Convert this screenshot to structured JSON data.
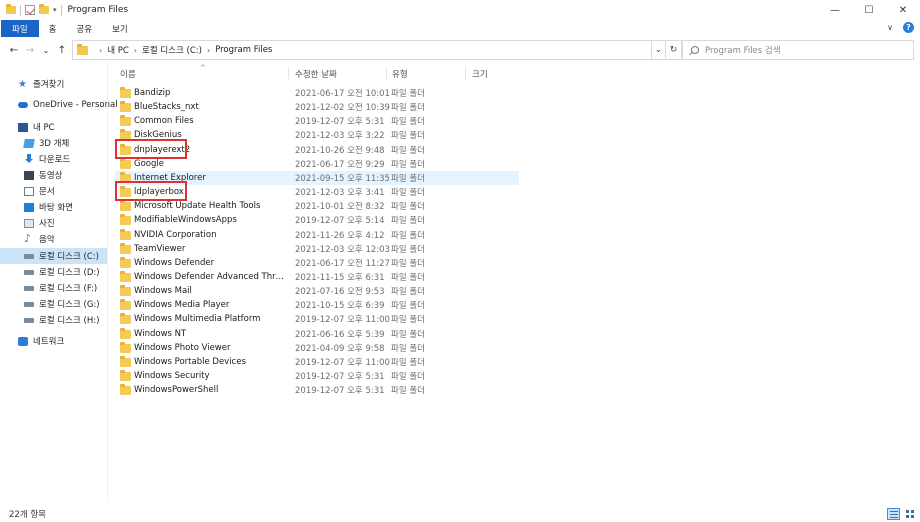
{
  "window": {
    "title": "Program Files",
    "minimize_glyph": "—",
    "maximize_glyph": "☐",
    "close_glyph": "✕"
  },
  "ribbon": {
    "tabs": [
      "파일",
      "홈",
      "공유",
      "보기"
    ],
    "help": "?"
  },
  "nav_buttons": {
    "back": "←",
    "forward": "→",
    "recent": "⌄",
    "up": "↑"
  },
  "address": {
    "crumbs": [
      "내 PC",
      "로컬 디스크 (C:)",
      "Program Files"
    ],
    "refresh": "↻",
    "dropdown": "⌄"
  },
  "search": {
    "placeholder": "Program Files 검색"
  },
  "sidebar": {
    "items": [
      {
        "label": "즐겨찾기",
        "icon": "star-icon"
      },
      {
        "label": "OneDrive - Personal",
        "icon": "cloud-icon"
      },
      {
        "label": "내 PC",
        "icon": "computer-icon"
      },
      {
        "label": "3D 개체",
        "icon": "cube-icon"
      },
      {
        "label": "다운로드",
        "icon": "download-icon"
      },
      {
        "label": "동영상",
        "icon": "video-icon"
      },
      {
        "label": "문서",
        "icon": "document-icon"
      },
      {
        "label": "바탕 화면",
        "icon": "desktop-icon"
      },
      {
        "label": "사진",
        "icon": "picture-icon"
      },
      {
        "label": "음악",
        "icon": "music-icon"
      },
      {
        "label": "로컬 디스크 (C:)",
        "icon": "drive-icon"
      },
      {
        "label": "로컬 디스크 (D:)",
        "icon": "drive-icon"
      },
      {
        "label": "로컬 디스크 (F:)",
        "icon": "drive-icon"
      },
      {
        "label": "로컬 디스크 (G:)",
        "icon": "drive-icon"
      },
      {
        "label": "로컬 디스크 (H:)",
        "icon": "drive-icon"
      },
      {
        "label": "네트워크",
        "icon": "network-icon"
      }
    ],
    "selected": "로컬 디스크 (C:)"
  },
  "columns": [
    "이름",
    "수정한 날짜",
    "유형",
    "크기"
  ],
  "files": [
    {
      "name": "Bandizip",
      "date": "2021-06-17 오전 10:01",
      "type": "파일 폴더"
    },
    {
      "name": "BlueStacks_nxt",
      "date": "2021-12-02 오전 10:39",
      "type": "파일 폴더"
    },
    {
      "name": "Common Files",
      "date": "2019-12-07 오후 5:31",
      "type": "파일 폴더"
    },
    {
      "name": "DiskGenius",
      "date": "2021-12-03 오후 3:22",
      "type": "파일 폴더"
    },
    {
      "name": "dnplayerext2",
      "date": "2021-10-26 오전 9:48",
      "type": "파일 폴더"
    },
    {
      "name": "Google",
      "date": "2021-06-17 오전 9:29",
      "type": "파일 폴더"
    },
    {
      "name": "Internet Explorer",
      "date": "2021-09-15 오후 11:35",
      "type": "파일 폴더"
    },
    {
      "name": "ldplayerbox",
      "date": "2021-12-03 오후 3:41",
      "type": "파일 폴더"
    },
    {
      "name": "Microsoft Update Health Tools",
      "date": "2021-10-01 오전 8:32",
      "type": "파일 폴더"
    },
    {
      "name": "ModifiableWindowsApps",
      "date": "2019-12-07 오후 5:14",
      "type": "파일 폴더"
    },
    {
      "name": "NVIDIA Corporation",
      "date": "2021-11-26 오후 4:12",
      "type": "파일 폴더"
    },
    {
      "name": "TeamViewer",
      "date": "2021-12-03 오후 12:03",
      "type": "파일 폴더"
    },
    {
      "name": "Windows Defender",
      "date": "2021-06-17 오전 11:27",
      "type": "파일 폴더"
    },
    {
      "name": "Windows Defender Advanced Threat Pr...",
      "date": "2021-11-15 오후 6:31",
      "type": "파일 폴더"
    },
    {
      "name": "Windows Mail",
      "date": "2021-07-16 오전 9:53",
      "type": "파일 폴더"
    },
    {
      "name": "Windows Media Player",
      "date": "2021-10-15 오후 6:39",
      "type": "파일 폴더"
    },
    {
      "name": "Windows Multimedia Platform",
      "date": "2019-12-07 오후 11:00",
      "type": "파일 폴더"
    },
    {
      "name": "Windows NT",
      "date": "2021-06-16 오후 5:39",
      "type": "파일 폴더"
    },
    {
      "name": "Windows Photo Viewer",
      "date": "2021-04-09 오후 9:58",
      "type": "파일 폴더"
    },
    {
      "name": "Windows Portable Devices",
      "date": "2019-12-07 오후 11:00",
      "type": "파일 폴더"
    },
    {
      "name": "Windows Security",
      "date": "2019-12-07 오후 5:31",
      "type": "파일 폴더"
    },
    {
      "name": "WindowsPowerShell",
      "date": "2019-12-07 오후 5:31",
      "type": "파일 폴더"
    }
  ],
  "hovered_file": "Internet Explorer",
  "highlighted_files": [
    "dnplayerext2",
    "ldplayerbox"
  ],
  "highlight_color": "#e03131",
  "accent_color": "#1a64c8",
  "status": {
    "item_count": "22개 항목"
  }
}
